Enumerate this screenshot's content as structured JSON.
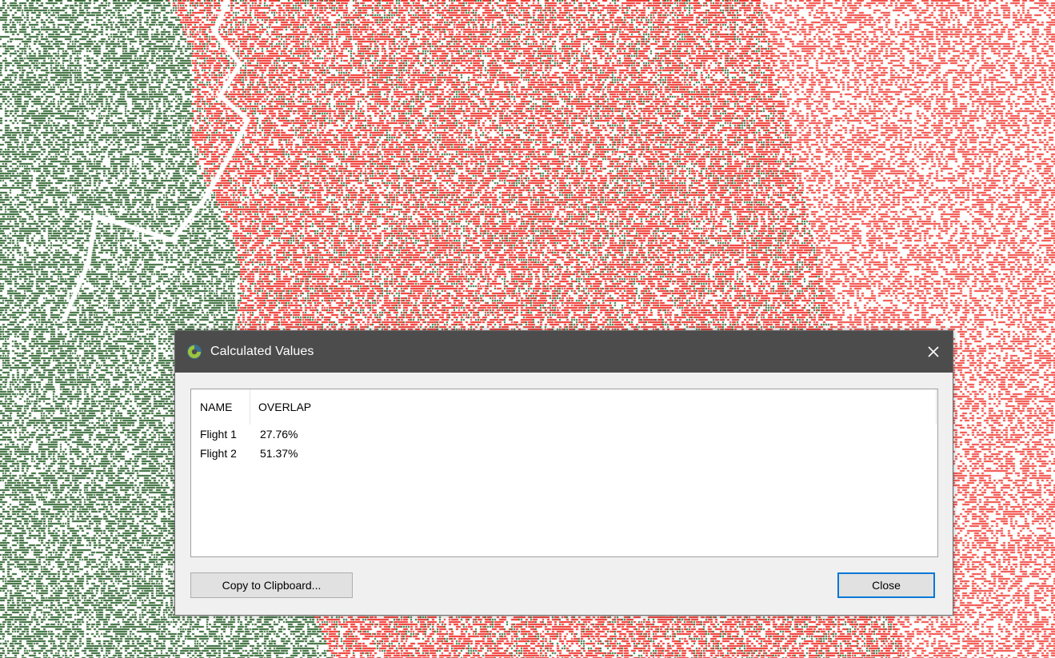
{
  "background": {
    "description_colors": {
      "green": "#2f6630",
      "red_dense": "#f0302a",
      "red_light": "#f24a42",
      "white": "#ffffff"
    }
  },
  "dialog": {
    "title": "Calculated Values",
    "icon": "app-logo-icon",
    "close_icon": "close-icon",
    "table": {
      "columns": [
        "NAME",
        "OVERLAP"
      ],
      "rows": [
        {
          "name": "Flight 1",
          "overlap": "27.76%"
        },
        {
          "name": "Flight 2",
          "overlap": "51.37%"
        }
      ]
    },
    "buttons": {
      "copy_label": "Copy to Clipboard...",
      "close_label": "Close"
    }
  }
}
